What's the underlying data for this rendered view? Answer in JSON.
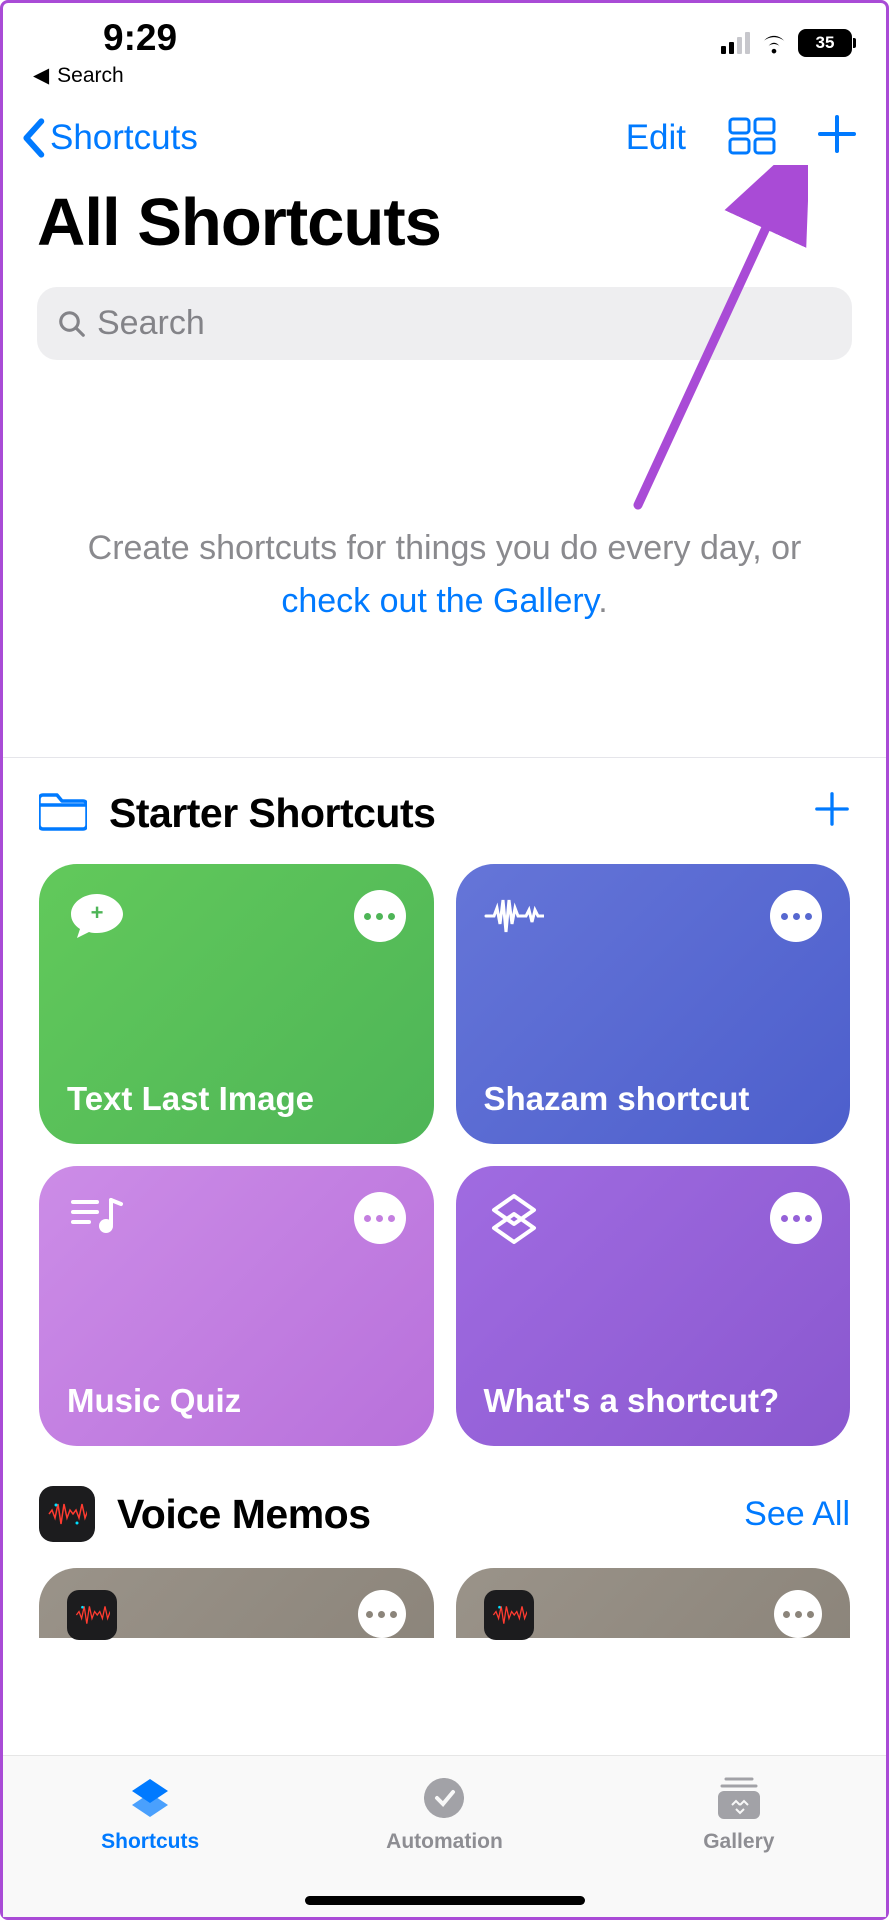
{
  "statusBar": {
    "time": "9:29",
    "backLabel": "Search",
    "battery": "35"
  },
  "nav": {
    "back": "Shortcuts",
    "edit": "Edit"
  },
  "pageTitle": "All Shortcuts",
  "search": {
    "placeholder": "Search"
  },
  "emptyState": {
    "prefix": "Create shortcuts for things you do every day, or ",
    "link": "check out the Gallery",
    "suffix": "."
  },
  "sections": {
    "starter": {
      "title": "Starter Shortcuts",
      "cards": [
        {
          "title": "Text Last Image"
        },
        {
          "title": "Shazam shortcut"
        },
        {
          "title": "Music Quiz"
        },
        {
          "title": "What's a shortcut?"
        }
      ]
    },
    "voiceMemos": {
      "title": "Voice Memos",
      "action": "See All"
    }
  },
  "tabs": {
    "shortcuts": "Shortcuts",
    "automation": "Automation",
    "gallery": "Gallery"
  }
}
